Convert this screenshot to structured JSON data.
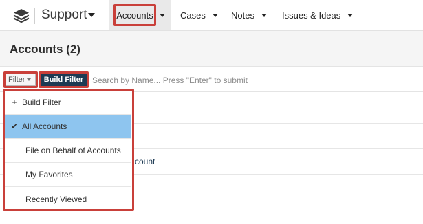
{
  "topnav": {
    "app_name": "Support",
    "items": [
      {
        "label": "Accounts"
      },
      {
        "label": "Cases"
      },
      {
        "label": "Notes"
      },
      {
        "label": "Issues & Ideas"
      }
    ]
  },
  "header": {
    "title": "Accounts (2)"
  },
  "filter_bar": {
    "filter_label": "Filter",
    "build_filter_label": "Build Filter",
    "search_placeholder": "Search by Name... Press \"Enter\" to submit"
  },
  "list": {
    "visible_fragment": "count"
  },
  "dropdown": {
    "items": [
      {
        "label": "Build Filter",
        "icon": "plus-icon"
      },
      {
        "label": "All Accounts",
        "icon": "check-icon",
        "selected": true
      },
      {
        "label": "File on Behalf of Accounts"
      },
      {
        "label": "My Favorites"
      },
      {
        "label": "Recently Viewed"
      }
    ]
  },
  "colors": {
    "highlight_border": "#c9403a",
    "build_button_bg": "#1d3a53",
    "selected_item_bg": "#8ec5ef"
  }
}
